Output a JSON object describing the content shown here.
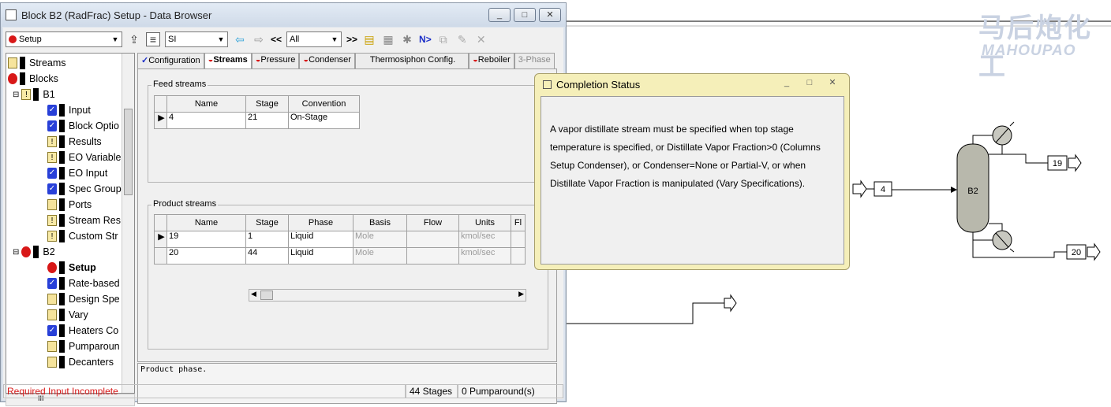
{
  "window": {
    "title": "Block B2 (RadFrac) Setup - Data Browser",
    "min_glyph": "_",
    "max_glyph": "□",
    "close_glyph": "✕"
  },
  "toolbar": {
    "form_selector": "Setup",
    "units": "SI",
    "prev_label": "<<",
    "filter": "All",
    "next_label": ">>",
    "next_input": "N>"
  },
  "tree": {
    "items": [
      {
        "label": "Streams"
      },
      {
        "label": "Blocks"
      },
      {
        "label": "B1"
      },
      {
        "label": "Input"
      },
      {
        "label": "Block Optio"
      },
      {
        "label": "Results"
      },
      {
        "label": "EO Variable"
      },
      {
        "label": "EO Input"
      },
      {
        "label": "Spec Group"
      },
      {
        "label": "Ports"
      },
      {
        "label": "Stream Res"
      },
      {
        "label": "Custom Str"
      },
      {
        "label": "B2"
      },
      {
        "label": "Setup"
      },
      {
        "label": "Rate-based"
      },
      {
        "label": "Design Spe"
      },
      {
        "label": "Vary"
      },
      {
        "label": "Heaters Co"
      },
      {
        "label": "Pumparoun"
      },
      {
        "label": "Decanters"
      }
    ],
    "hscroll_thumb": "III"
  },
  "tabs": [
    {
      "label": "Configuration"
    },
    {
      "label": "Streams"
    },
    {
      "label": "Pressure"
    },
    {
      "label": "Condenser"
    },
    {
      "label": "Thermosiphon Config."
    },
    {
      "label": "Reboiler"
    },
    {
      "label": "3-Phase"
    }
  ],
  "feed": {
    "title": "Feed streams",
    "headers": [
      "Name",
      "Stage",
      "Convention"
    ],
    "rows": [
      {
        "name": "4",
        "stage": "21",
        "convention": "On-Stage"
      }
    ]
  },
  "product": {
    "title": "Product streams",
    "headers": [
      "Name",
      "Stage",
      "Phase",
      "Basis",
      "Flow",
      "Units",
      "Fl"
    ],
    "rows": [
      {
        "name": "19",
        "stage": "1",
        "phase": "Liquid",
        "basis": "Mole",
        "flow": "",
        "units": "kmol/sec"
      },
      {
        "name": "20",
        "stage": "44",
        "phase": "Liquid",
        "basis": "Mole",
        "flow": "",
        "units": "kmol/sec"
      }
    ]
  },
  "prompt": "Product phase.",
  "status": {
    "message": "Required Input Incomplete",
    "stages": "44 Stages",
    "pumparounds": "0 Pumparound(s)"
  },
  "dialog": {
    "title": "Completion Status",
    "message": "A vapor distillate stream must be specified when top stage temperature is specified, or Distillate Vapor Fraction>0 (Columns Setup Condenser), or Condenser=None or Partial-V, or when Distillate Vapor Fraction is manipulated (Vary Specifications)."
  },
  "flowsheet": {
    "block": "B2",
    "feed_stream": "4",
    "top_stream": "19",
    "bottom_stream": "20"
  },
  "watermark": {
    "cn": "马后炮化工",
    "en": "MAHOUPAO"
  }
}
